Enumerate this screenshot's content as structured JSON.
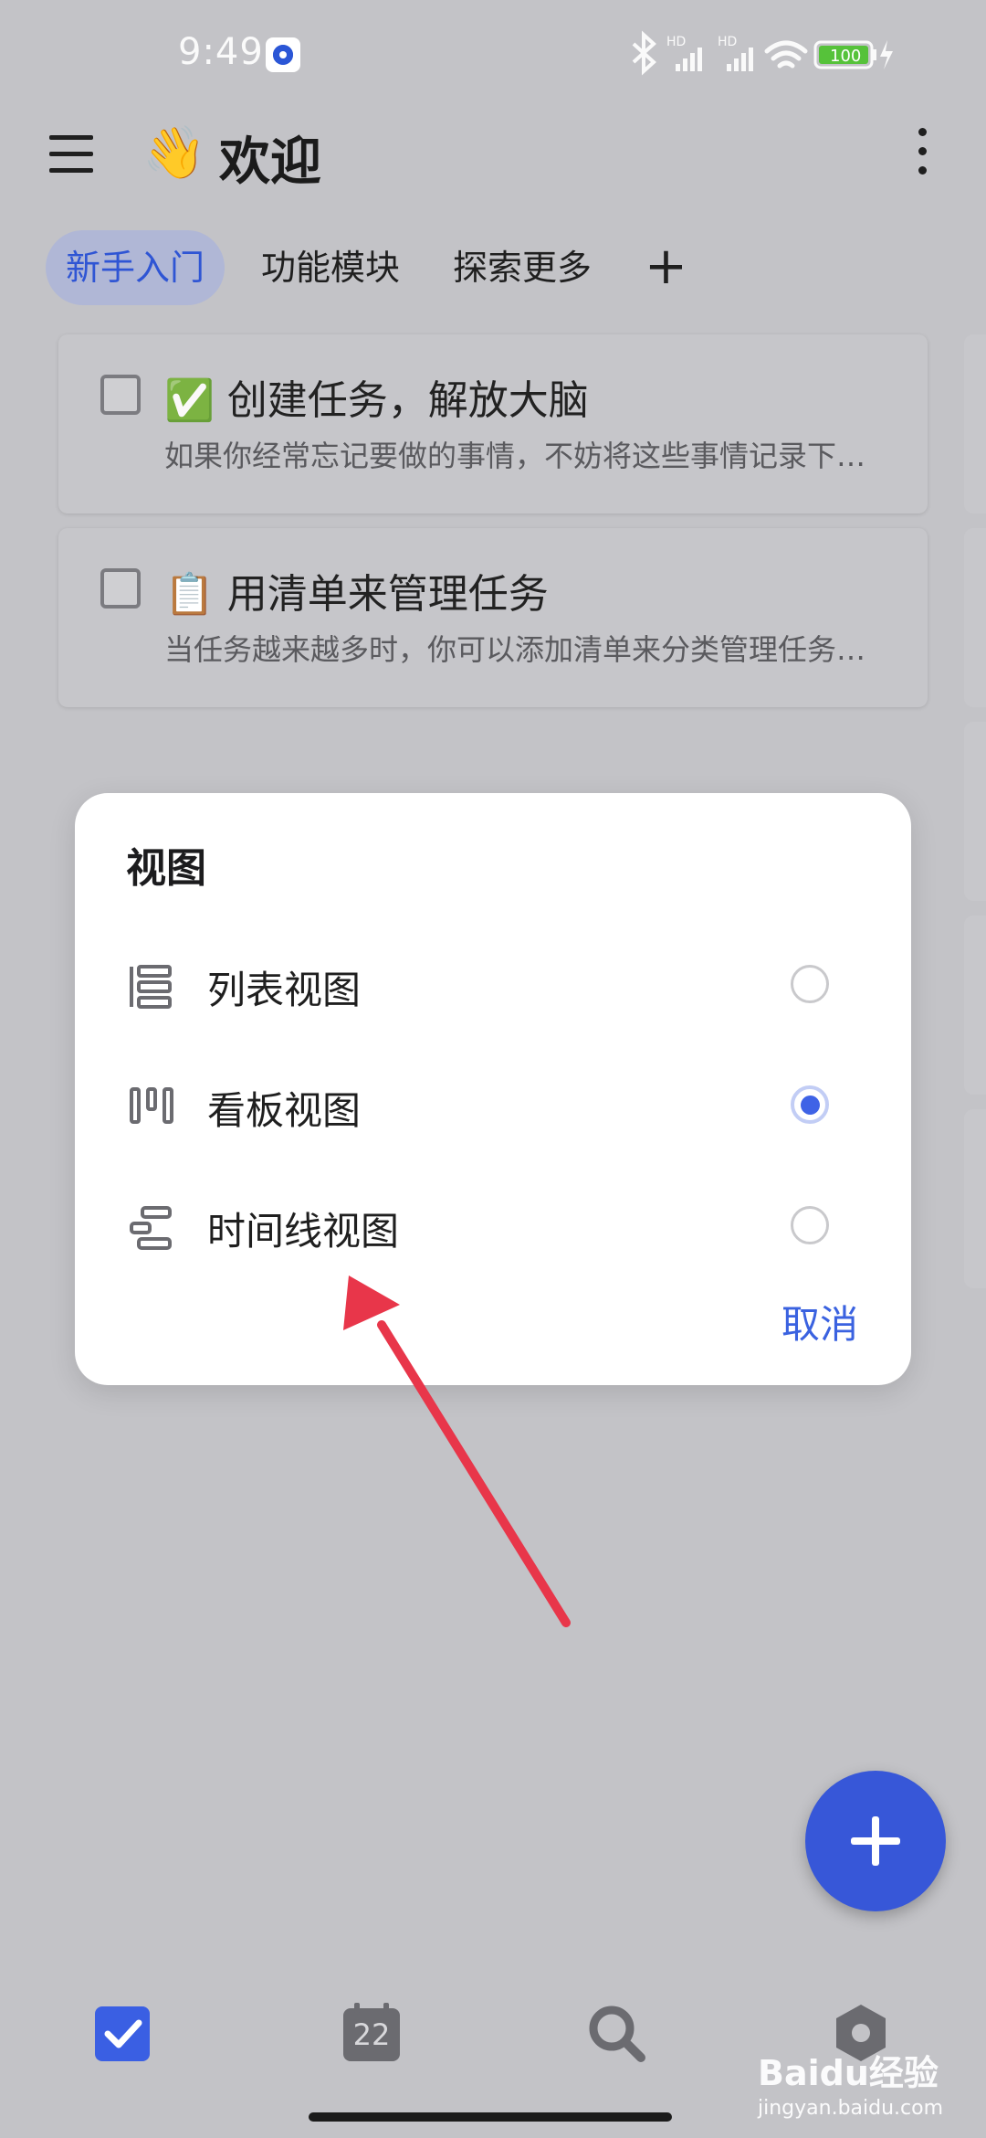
{
  "status_bar": {
    "time": "9:49",
    "battery": "100"
  },
  "header": {
    "emoji": "👋",
    "title": "欢迎"
  },
  "tabs": [
    {
      "label": "新手入门",
      "active": true
    },
    {
      "label": "功能模块",
      "active": false
    },
    {
      "label": "探索更多",
      "active": false
    }
  ],
  "tab_add_label": "+",
  "tasks": [
    {
      "emoji": "✅",
      "title": "创建任务，解放大脑",
      "desc": "如果你经常忘记要做的事情，不妨将这些事情记录下…"
    },
    {
      "emoji": "📋",
      "title": "用清单来管理任务",
      "desc": "当任务越来越多时，你可以添加清单来分类管理任务…"
    }
  ],
  "dialog": {
    "title": "视图",
    "options": [
      {
        "label": "列表视图",
        "icon": "list-view-icon",
        "selected": false
      },
      {
        "label": "看板视图",
        "icon": "kanban-view-icon",
        "selected": true
      },
      {
        "label": "时间线视图",
        "icon": "timeline-view-icon",
        "selected": false
      }
    ],
    "cancel": "取消"
  },
  "bottom_nav": {
    "calendar_day": "22"
  },
  "watermark": {
    "brand": "Baidu经验",
    "url": "jingyan.baidu.com"
  },
  "colors": {
    "accent": "#3757d8",
    "arrow": "#e8364a",
    "overlay_bg": "#c3c3c7"
  }
}
